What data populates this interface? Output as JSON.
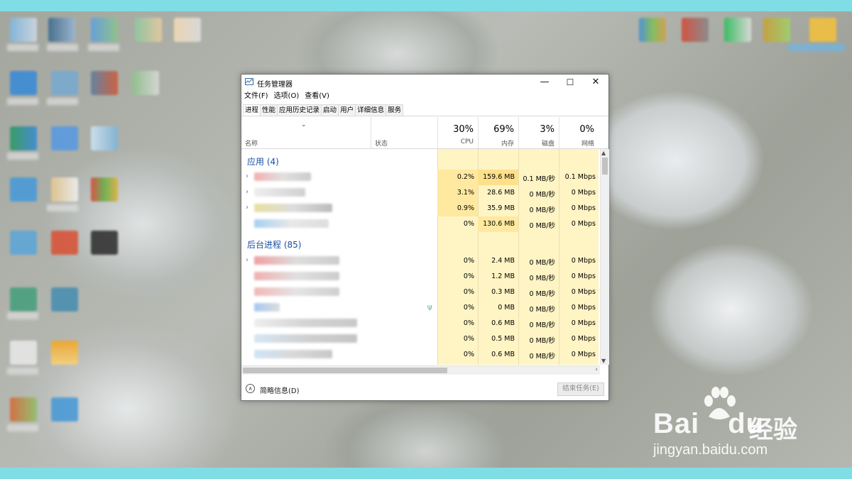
{
  "window": {
    "title": "任务管理器",
    "minimize": "—",
    "maximize": "☐",
    "close": "✕"
  },
  "menu": [
    "文件(F)",
    "选项(O)",
    "查看(V)"
  ],
  "tabs": [
    "进程",
    "性能",
    "应用历史记录",
    "启动",
    "用户",
    "详细信息",
    "服务"
  ],
  "active_tab": "进程",
  "columns": {
    "name": "名称",
    "status": "状态",
    "cpu": {
      "pct": "30%",
      "label": "CPU"
    },
    "memory": {
      "pct": "69%",
      "label": "内存"
    },
    "disk": {
      "pct": "3%",
      "label": "磁盘"
    },
    "network": {
      "pct": "0%",
      "label": "网络"
    }
  },
  "groups": {
    "apps": "应用 (4)",
    "background": "后台进程 (85)"
  },
  "app_rows": [
    {
      "cpu": "0.2%",
      "mem": "159.6 MB",
      "disk": "0.1 MB/秒",
      "net": "0.1 Mbps"
    },
    {
      "cpu": "3.1%",
      "mem": "28.6 MB",
      "disk": "0 MB/秒",
      "net": "0 Mbps"
    },
    {
      "cpu": "0.9%",
      "mem": "35.9 MB",
      "disk": "0 MB/秒",
      "net": "0 Mbps"
    },
    {
      "cpu": "0%",
      "mem": "130.6 MB",
      "disk": "0 MB/秒",
      "net": "0 Mbps"
    }
  ],
  "bg_rows": [
    {
      "cpu": "0%",
      "mem": "2.4 MB",
      "disk": "0 MB/秒",
      "net": "0 Mbps"
    },
    {
      "cpu": "0%",
      "mem": "1.2 MB",
      "disk": "0 MB/秒",
      "net": "0 Mbps"
    },
    {
      "cpu": "0%",
      "mem": "0.3 MB",
      "disk": "0 MB/秒",
      "net": "0 Mbps"
    },
    {
      "cpu": "0%",
      "mem": "0 MB",
      "disk": "0 MB/秒",
      "net": "0 Mbps"
    },
    {
      "cpu": "0%",
      "mem": "0.6 MB",
      "disk": "0 MB/秒",
      "net": "0 Mbps"
    },
    {
      "cpu": "0%",
      "mem": "0.5 MB",
      "disk": "0 MB/秒",
      "net": "0 Mbps"
    },
    {
      "cpu": "0%",
      "mem": "0.6 MB",
      "disk": "0 MB/秒",
      "net": "0 Mbps"
    }
  ],
  "footer": {
    "fewer_details": "简略信息(D)",
    "end_task": "结束任务(E)"
  },
  "watermark": {
    "brand_latin": "Bai",
    "brand_du": "du",
    "brand_cn": "经验",
    "url": "jingyan.baidu.com"
  },
  "colors": {
    "group_header": "#1a4fa3",
    "heat_light": "#fff4c4",
    "heat_medium": "#ffe9a0",
    "taskbar": "#7fdde6"
  }
}
